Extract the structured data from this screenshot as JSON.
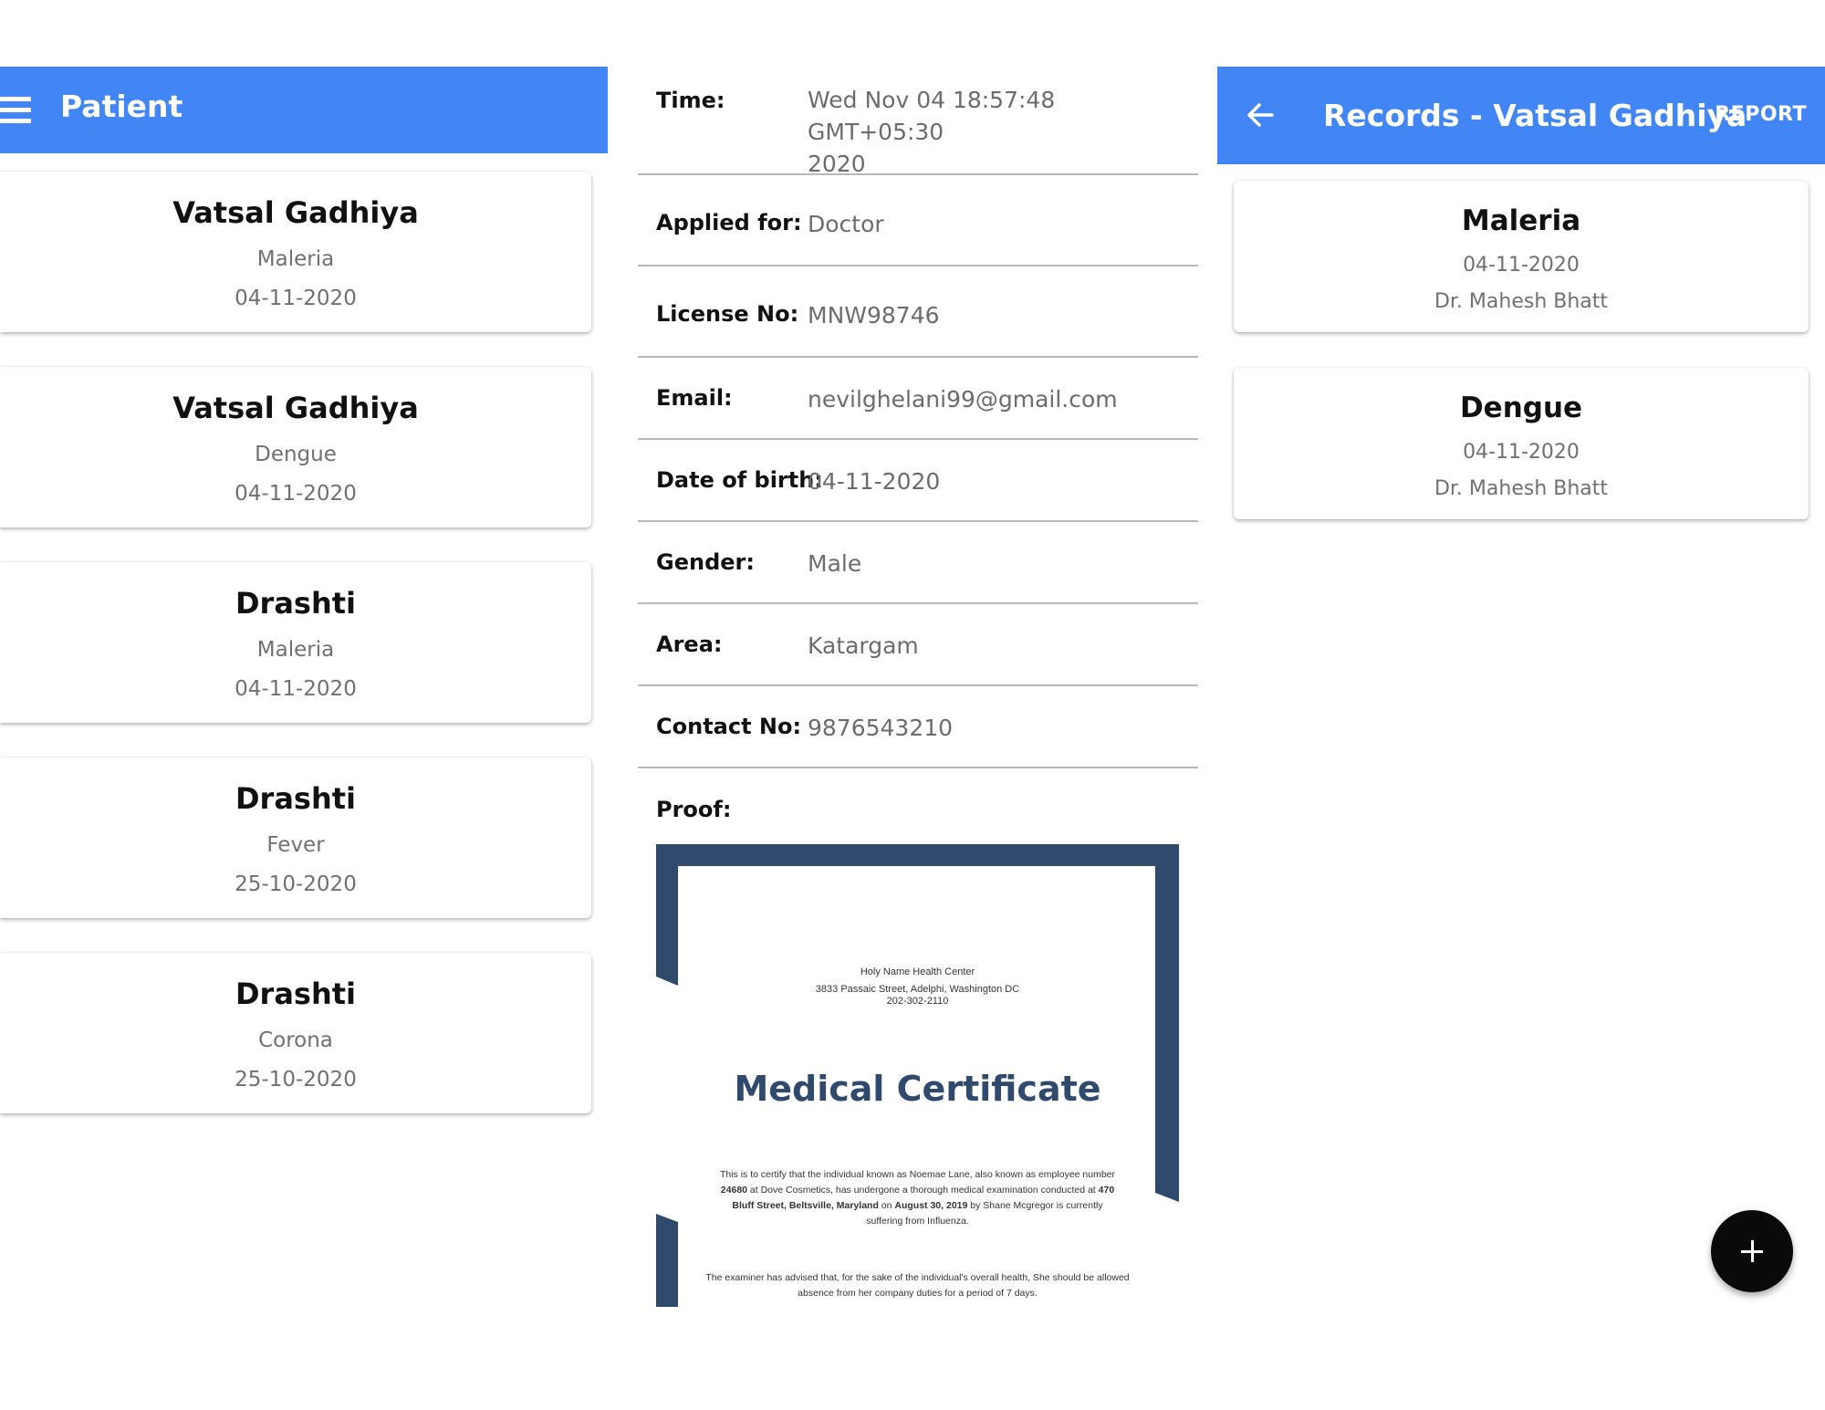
{
  "patient_screen": {
    "title": "Patient",
    "patients": [
      {
        "name": "Vatsal Gadhiya",
        "disease": "Maleria",
        "date": "04-11-2020"
      },
      {
        "name": "Vatsal Gadhiya",
        "disease": "Dengue",
        "date": "04-11-2020"
      },
      {
        "name": "Drashti",
        "disease": "Maleria",
        "date": "04-11-2020"
      },
      {
        "name": "Drashti",
        "disease": "Fever",
        "date": "25-10-2020"
      },
      {
        "name": "Drashti",
        "disease": "Corona",
        "date": "25-10-2020"
      }
    ]
  },
  "application_screen": {
    "time": {
      "label": "Time:",
      "value_line1": "Wed Nov 04 18:57:48 GMT+05:30",
      "value_line2": "2020"
    },
    "fields": [
      {
        "label": "Applied for:",
        "value": "Doctor"
      },
      {
        "label": "License No:",
        "value": "MNW98746"
      },
      {
        "label": "Email:",
        "value": "nevilghelani99@gmail.com"
      },
      {
        "label": "Date of birth:",
        "value": "04-11-2020"
      },
      {
        "label": "Gender:",
        "value": "Male"
      },
      {
        "label": "Area:",
        "value": "Katargam"
      },
      {
        "label": "Contact No:",
        "value": "9876543210"
      }
    ],
    "proof_label": "Proof:",
    "certificate": {
      "organization": "Holy Name Health Center",
      "address": "3833 Passaic Street, Adelphi, Washington DC",
      "phone": "202-302-2110",
      "title": "Medical Certificate",
      "body1_a": "This is to certify that the individual known as Noemae Lane, also known as employee number ",
      "body1_b": "24680",
      "body1_c": " at Dove Cosmetics, has undergone a thorough medical examination conducted at ",
      "body1_d": "470 Bluff Street, Beltsville, Maryland",
      "body1_e": " on ",
      "body1_f": "August 30, 2019",
      "body1_g": " by Shane Mcgregor is currently suffering from Influenza.",
      "body2": "The examiner has advised that, for the sake of the individual's overall health, She should be allowed absence from her company duties for a period of 7 days.",
      "frame_color": "#2f4a6d"
    }
  },
  "records_screen": {
    "title": "Records - Vatsal Gadhiya",
    "report_label": "REPORT",
    "records": [
      {
        "disease": "Maleria",
        "date": "04-11-2020",
        "doctor": "Dr. Mahesh Bhatt"
      },
      {
        "disease": "Dengue",
        "date": "04-11-2020",
        "doctor": "Dr. Mahesh Bhatt"
      }
    ],
    "fab_icon": "plus-icon"
  },
  "colors": {
    "app_bar": "#4285f4",
    "fab": "#0a0a0a",
    "certificate_frame": "#2f4a6d"
  }
}
